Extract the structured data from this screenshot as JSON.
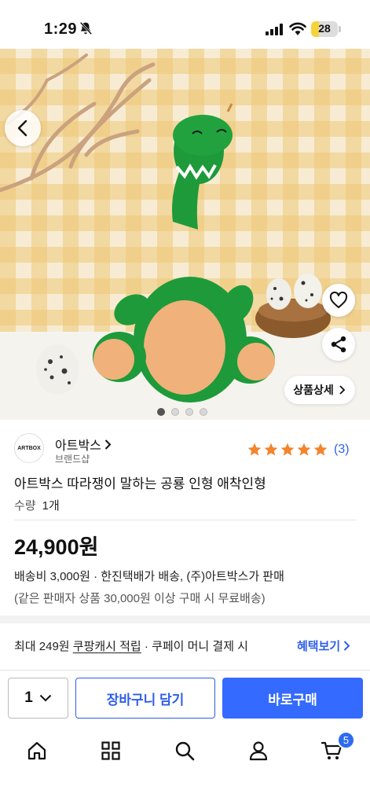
{
  "status_bar": {
    "time": "1:29",
    "battery": "28",
    "battery_level": 0.28
  },
  "product": {
    "image_count": 4,
    "active_image_index": 0,
    "detail_button": "상품상세",
    "wishlist": false
  },
  "seller": {
    "logo_text": "ARTBOX",
    "name": "아트박스",
    "type": "브랜드샵"
  },
  "rating": {
    "stars": 5,
    "count": "(3)",
    "star_color": "#f2852e"
  },
  "info": {
    "title": "아트박스 따라쟁이 말하는 공룡 인형 애착인형",
    "quantity_label": "수량",
    "quantity_value": "1개",
    "price": "24,900원",
    "shipping": "배송비 3,000원 · 한진택배가 배송, (주)아트박스가 판매",
    "free_shipping": "(같은 판매자 상품 30,000원 이상 구매 시 무료배송)"
  },
  "benefit": {
    "prefix": "최대 249원 ",
    "highlight": "쿠팡캐시 적립",
    "suffix": " · 쿠페이 머니 결제 시",
    "link": "혜택보기"
  },
  "actions": {
    "quantity": "1",
    "cart": "장바구니 담기",
    "buy": "바로구매"
  },
  "tabbar": {
    "items": [
      "home-icon",
      "category-icon",
      "search-icon",
      "user-icon",
      "cart-icon"
    ],
    "cart_badge": "5"
  },
  "colors": {
    "accent": "#346aff",
    "link": "#2e5fe8",
    "star": "#f2852e"
  }
}
